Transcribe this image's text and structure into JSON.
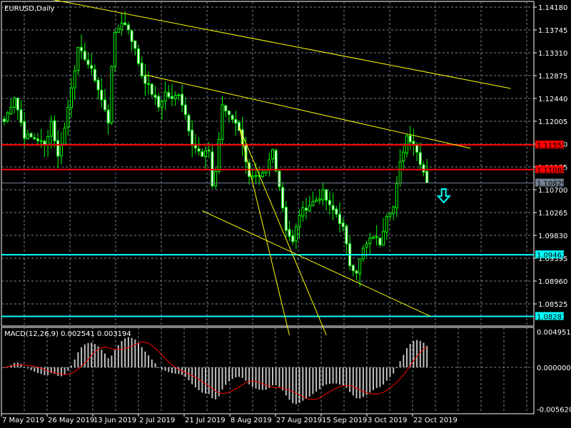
{
  "window": {
    "title": "EURUSD,Daily"
  },
  "macd_label": {
    "name": "MACD(12,26,9)",
    "main": "0.002541",
    "signal": "0.003194"
  },
  "price_axis": {
    "ticks": [
      "1.14180",
      "1.13745",
      "1.13310",
      "1.12875",
      "1.12440",
      "1.12005",
      "1.11570",
      "1.11135",
      "1.10700",
      "1.10265",
      "1.09830",
      "1.09395",
      "1.08960",
      "1.08525"
    ],
    "tick_values": [
      1.1418,
      1.13745,
      1.1331,
      1.12875,
      1.1244,
      1.12005,
      1.1157,
      1.11135,
      1.107,
      1.10265,
      1.0983,
      1.09395,
      1.0896,
      1.08525
    ],
    "range": [
      1.0795,
      1.1423
    ]
  },
  "macd_axis": {
    "ticks": [
      "0.004951",
      "0.000000",
      "-0.005620"
    ],
    "tick_values": [
      0.004951,
      0,
      -0.00562
    ]
  },
  "levels": [
    {
      "label": "1.11555",
      "value": 1.11555,
      "color": "#ff0000",
      "text_color": "#000000"
    },
    {
      "label": "1.11084",
      "value": 1.11084,
      "color": "#ff0000",
      "text_color": "#000000"
    },
    {
      "label": "1.10829",
      "value": 1.10829,
      "color": "#708090",
      "text_color": "#000000"
    },
    {
      "label": "1.09462",
      "value": 1.09462,
      "color": "#00ffff",
      "text_color": "#000000"
    },
    {
      "label": "1.08287",
      "value": 1.08287,
      "color": "#00ffff",
      "text_color": "#000000"
    }
  ],
  "trendlines": [
    {
      "from": [
        13,
        1.1434
      ],
      "to": [
        151,
        1.1263
      ]
    },
    {
      "from": [
        42,
        1.1289
      ],
      "to": [
        139,
        1.1149
      ]
    },
    {
      "from": [
        59,
        1.103
      ],
      "to": [
        127,
        1.0829
      ]
    },
    {
      "from": [
        70,
        1.119
      ],
      "to": [
        85,
        1.0793
      ]
    },
    {
      "from": [
        70,
        1.119
      ],
      "to": [
        96,
        1.0793
      ]
    }
  ],
  "signal_arrow": {
    "icon": "down-arrow-icon",
    "bar": 131,
    "price": 1.1058,
    "color": "#00ffff"
  },
  "date_axis": [
    "7 May 2019",
    "26 May 2019",
    "13 Jun 2019",
    "2 Jul 2019",
    "21 Jul 2019",
    "8 Aug 2019",
    "27 Aug 2019",
    "15 Sep 2019",
    "3 Oct 2019",
    "22 Oct 2019"
  ],
  "colors": {
    "candle": "#00ff00",
    "bull_body": "#000000",
    "bear_body": "#ffffff",
    "trendline": "#ffff00",
    "macd_hist": "#c0c0c0",
    "macd_signal": "#ff0000",
    "grid": "#778899"
  },
  "chart_data": {
    "type": "candlestick",
    "symbol": "EURUSD",
    "timeframe": "Daily",
    "close_keypoints": [
      [
        0,
        1.12
      ],
      [
        3,
        1.1248
      ],
      [
        6,
        1.1173
      ],
      [
        10,
        1.1166
      ],
      [
        12,
        1.1153
      ],
      [
        14,
        1.12
      ],
      [
        16,
        1.1132
      ],
      [
        18,
        1.1187
      ],
      [
        20,
        1.1268
      ],
      [
        22,
        1.1336
      ],
      [
        24,
        1.1323
      ],
      [
        27,
        1.1282
      ],
      [
        29,
        1.1241
      ],
      [
        31,
        1.12
      ],
      [
        32,
        1.1309
      ],
      [
        33,
        1.1364
      ],
      [
        35,
        1.1391
      ],
      [
        37,
        1.1377
      ],
      [
        39,
        1.1336
      ],
      [
        41,
        1.1289
      ],
      [
        44,
        1.1255
      ],
      [
        46,
        1.1228
      ],
      [
        48,
        1.1255
      ],
      [
        50,
        1.1241
      ],
      [
        52,
        1.1255
      ],
      [
        54,
        1.1214
      ],
      [
        56,
        1.116
      ],
      [
        59,
        1.1132
      ],
      [
        61,
        1.1146
      ],
      [
        62,
        1.1078
      ],
      [
        63,
        1.1105
      ],
      [
        65,
        1.1228
      ],
      [
        67,
        1.1214
      ],
      [
        69,
        1.12
      ],
      [
        71,
        1.116
      ],
      [
        73,
        1.1092
      ],
      [
        76,
        1.1092
      ],
      [
        78,
        1.1105
      ],
      [
        80,
        1.1146
      ],
      [
        82,
        1.1078
      ],
      [
        84,
        1.0996
      ],
      [
        86,
        1.0969
      ],
      [
        88,
        1.1024
      ],
      [
        90,
        1.1037
      ],
      [
        93,
        1.1051
      ],
      [
        95,
        1.1064
      ],
      [
        97,
        1.1037
      ],
      [
        99,
        1.1024
      ],
      [
        101,
        1.0996
      ],
      [
        103,
        1.0928
      ],
      [
        105,
        1.0915
      ],
      [
        107,
        1.0956
      ],
      [
        110,
        1.0983
      ],
      [
        112,
        1.0969
      ],
      [
        114,
        1.1024
      ],
      [
        116,
        1.1037
      ],
      [
        118,
        1.1119
      ],
      [
        120,
        1.1173
      ],
      [
        122,
        1.116
      ],
      [
        125,
        1.1105
      ],
      [
        126,
        1.10829
      ]
    ],
    "indicator": {
      "name": "MACD",
      "params": [
        12,
        26,
        9
      ],
      "main": 0.002541,
      "signal": 0.003194,
      "range": [
        -0.00562,
        0.004951
      ]
    }
  }
}
